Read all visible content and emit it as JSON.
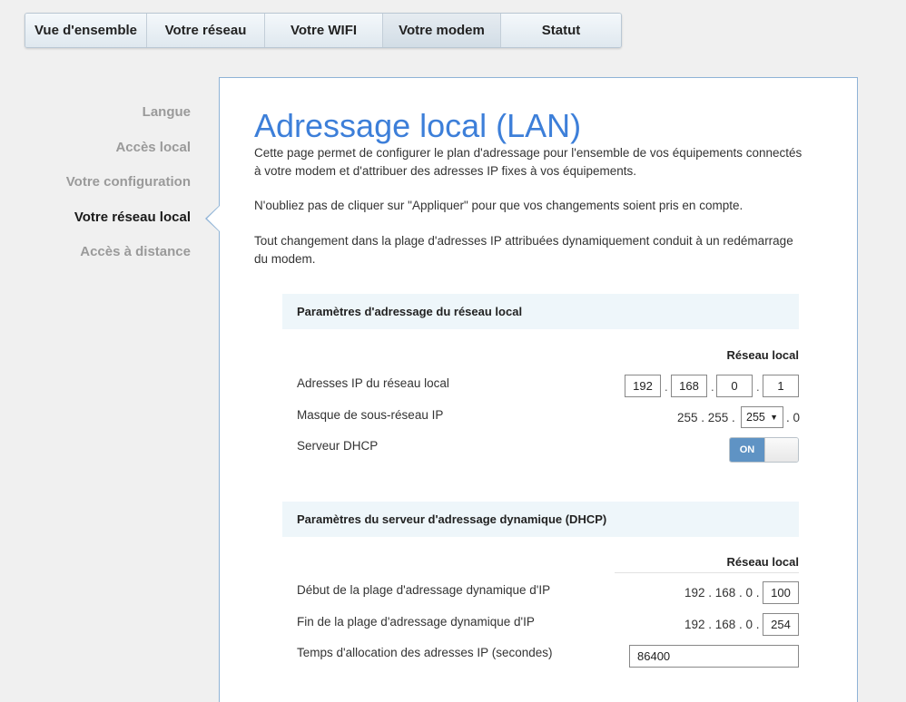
{
  "tabs": [
    {
      "label": "Vue d'ensemble"
    },
    {
      "label": "Votre réseau"
    },
    {
      "label": "Votre WIFI"
    },
    {
      "label": "Votre modem"
    },
    {
      "label": "Statut"
    }
  ],
  "active_tab": "Votre modem",
  "sidenav": [
    {
      "label": "Langue"
    },
    {
      "label": "Accès local"
    },
    {
      "label": "Votre configuration"
    },
    {
      "label": "Votre réseau local"
    },
    {
      "label": "Accès à distance"
    }
  ],
  "active_sidenav": "Votre réseau local",
  "page": {
    "title": "Adressage local (LAN)",
    "para1": "Cette page permet de configurer le plan d'adressage pour l'ensemble de vos équipements connectés à votre modem et d'attribuer des adresses IP fixes à vos équipements.",
    "para2": "N'oubliez pas de cliquer sur \"Appliquer\" pour que vos changements soient pris en compte.",
    "para3": "Tout changement dans la plage d'adresses IP attribuées dynamiquement conduit à un redémarrage du modem."
  },
  "lan_section": {
    "header": "Paramètres d'adressage du réseau local",
    "column": "Réseau local",
    "ip_label": "Adresses IP du réseau local",
    "ip": [
      "192",
      "168",
      "0",
      "1"
    ],
    "mask_label": "Masque de sous-réseau IP",
    "mask_prefix": "255 . 255 .",
    "mask_select": "255",
    "mask_suffix": ". 0",
    "dhcp_label": "Serveur DHCP",
    "dhcp_state": "ON"
  },
  "dhcp_section": {
    "header": "Paramètres du serveur d'adressage dynamique (DHCP)",
    "column": "Réseau local",
    "start_label": "Début de la plage d'adressage dynamique d'IP",
    "start_prefix": "192 . 168 . 0 .",
    "start_value": "100",
    "end_label": "Fin de la plage d'adressage dynamique d'IP",
    "end_prefix": "192 . 168 . 0 .",
    "end_value": "254",
    "lease_label": "Temps d'allocation des adresses IP (secondes)",
    "lease_value": "86400"
  },
  "colors": {
    "accent": "#3d7fd9",
    "toggle_on": "#5f93c4",
    "section_bg": "#eef6fa"
  }
}
